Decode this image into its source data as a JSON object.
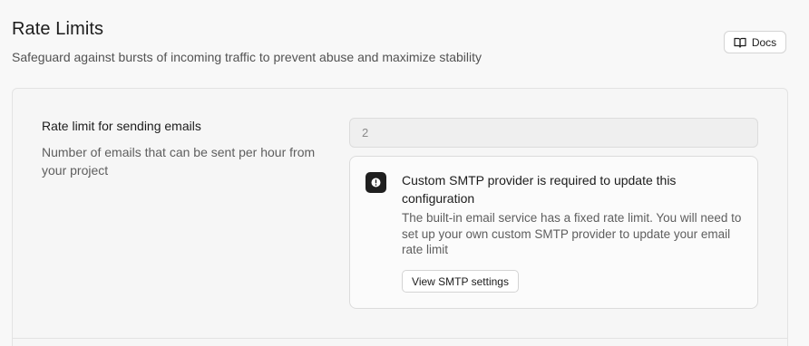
{
  "header": {
    "title": "Rate Limits",
    "subtitle": "Safeguard against bursts of incoming traffic to prevent abuse and maximize stability",
    "docs_label": "Docs",
    "docs_icon": "book-open-icon"
  },
  "email_rate_limit": {
    "label": "Rate limit for sending emails",
    "description": "Number of emails that can be sent per hour from your project",
    "value": "2"
  },
  "alert": {
    "icon": "alert-exclamation-icon",
    "title": "Custom SMTP provider is required to update this configuration",
    "body": "The built-in email service has a fixed rate limit. You will need to set up your own custom SMTP provider to update your email rate limit",
    "button_label": "View SMTP settings"
  }
}
